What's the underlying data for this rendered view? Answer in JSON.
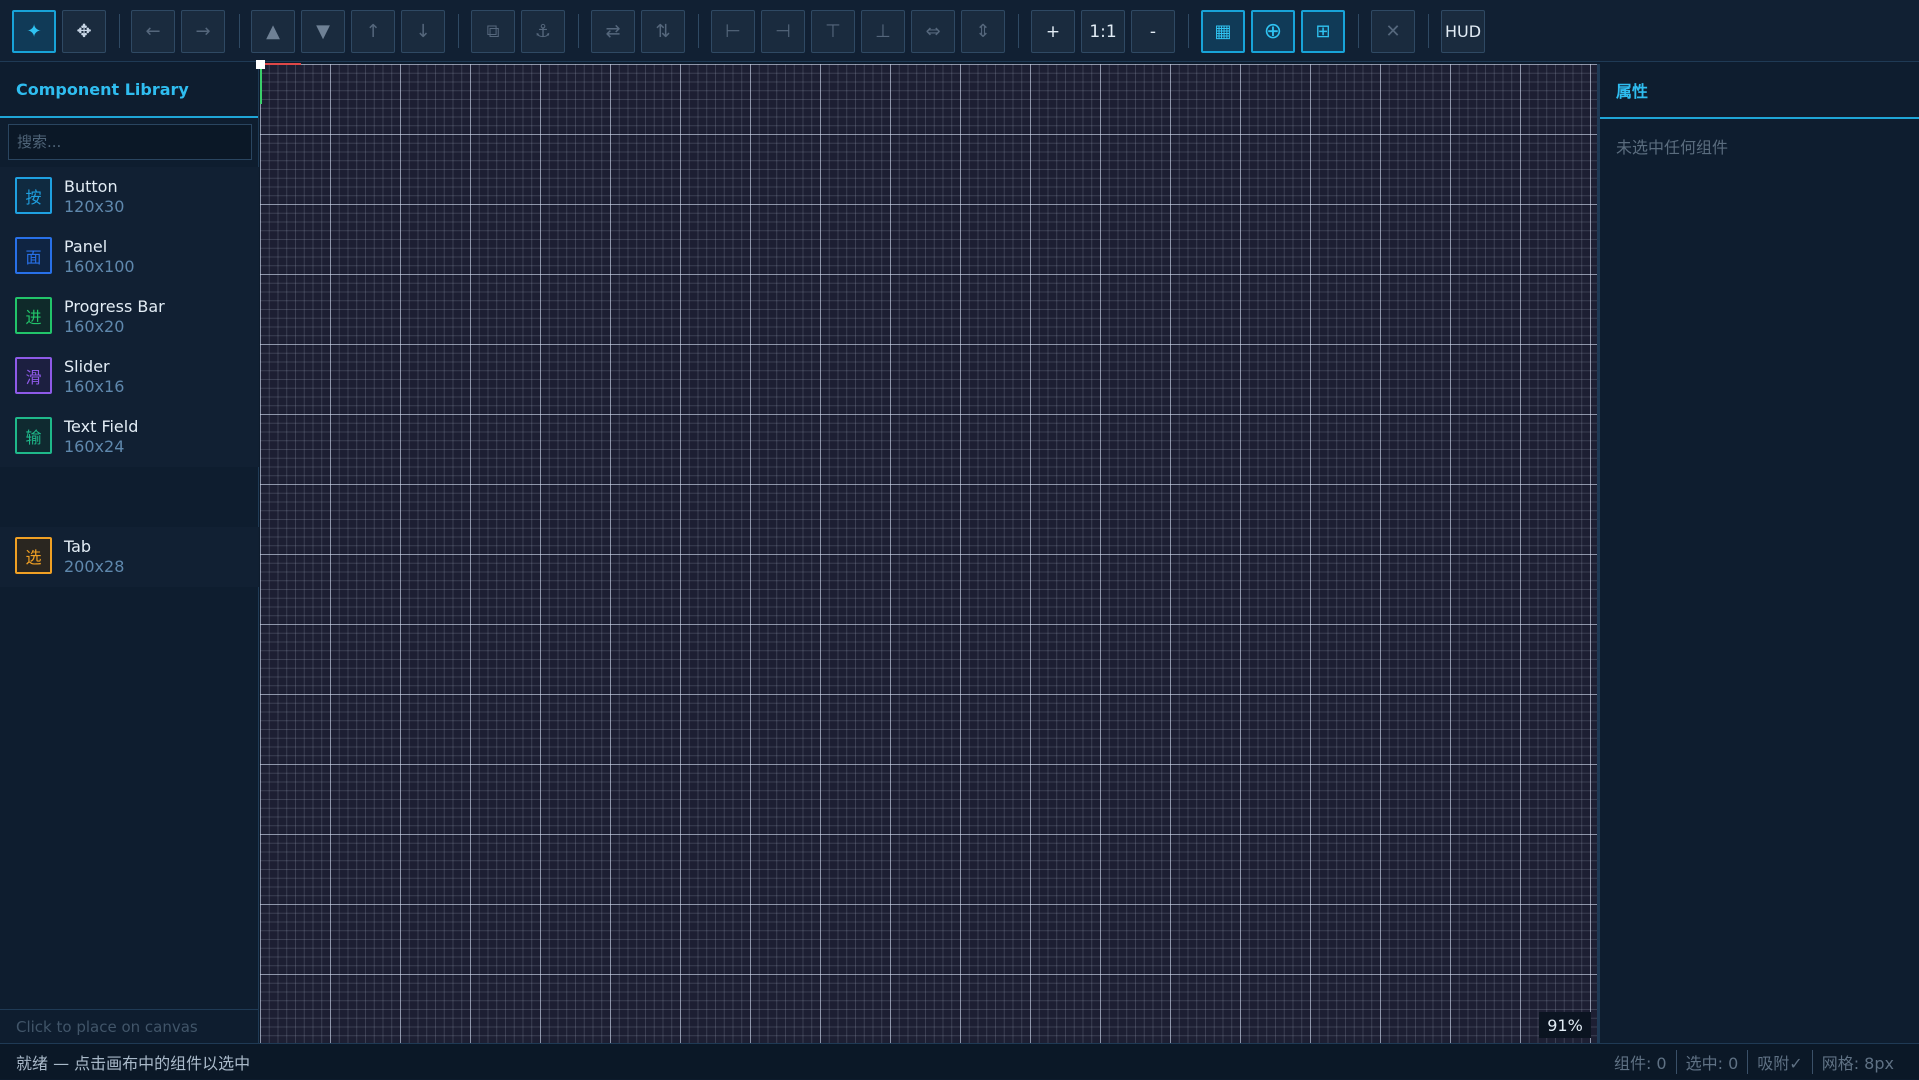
{
  "toolbar": {
    "buttons": [
      {
        "id": "select",
        "glyph": "✦",
        "active": true
      },
      {
        "id": "pan",
        "glyph": "✥",
        "active": false
      },
      {
        "id": "undo",
        "glyph": "←"
      },
      {
        "id": "redo",
        "glyph": "→"
      },
      {
        "id": "bring-front",
        "glyph": "▲"
      },
      {
        "id": "send-back",
        "glyph": "▼"
      },
      {
        "id": "move-up",
        "glyph": "↑"
      },
      {
        "id": "move-down",
        "glyph": "↓"
      },
      {
        "id": "duplicate",
        "glyph": "⧉"
      },
      {
        "id": "anchor",
        "glyph": "⚓"
      },
      {
        "id": "flip-h",
        "glyph": "⇄"
      },
      {
        "id": "flip-v",
        "glyph": "⇅"
      },
      {
        "id": "align-left",
        "glyph": "⊢"
      },
      {
        "id": "align-right",
        "glyph": "⊣"
      },
      {
        "id": "align-top",
        "glyph": "⊤"
      },
      {
        "id": "align-bottom",
        "glyph": "⊥"
      },
      {
        "id": "distribute-h",
        "glyph": "⇔"
      },
      {
        "id": "distribute-v",
        "glyph": "⇕"
      },
      {
        "id": "zoom-in",
        "label": "+"
      },
      {
        "id": "zoom-reset",
        "label": "1:1"
      },
      {
        "id": "zoom-out",
        "label": "-"
      },
      {
        "id": "grid-toggle",
        "glyph": "▦",
        "active": true
      },
      {
        "id": "crosshair-toggle",
        "glyph": "⊕",
        "active": true
      },
      {
        "id": "snap-toggle",
        "glyph": "⊞",
        "active": true
      },
      {
        "id": "delete",
        "glyph": "✕"
      },
      {
        "id": "hud",
        "label": "HUD"
      }
    ]
  },
  "left_panel": {
    "title": "Component Library",
    "search_placeholder": "搜索...",
    "footer": "Click to place on canvas",
    "components": [
      {
        "icon": "按",
        "name": "Button",
        "size": "120x30",
        "color": "#1fa0e0"
      },
      {
        "icon": "面",
        "name": "Panel",
        "size": "160x100",
        "color": "#2870e8"
      },
      {
        "icon": "进",
        "name": "Progress Bar",
        "size": "160x20",
        "color": "#22c46a"
      },
      {
        "icon": "滑",
        "name": "Slider",
        "size": "160x16",
        "color": "#8e5ae8"
      },
      {
        "icon": "输",
        "name": "Text Field",
        "size": "160x24",
        "color": "#1fb88a"
      },
      {
        "icon": "选",
        "name": "Tab",
        "size": "200x28",
        "color": "#f0a024"
      }
    ]
  },
  "canvas": {
    "zoom": "91%"
  },
  "right_panel": {
    "title": "属性",
    "empty_text": "未选中任何组件"
  },
  "status": {
    "message": "就绪 — 点击画布中的组件以选中",
    "components": "组件: 0",
    "selected": "选中: 0",
    "snap": "吸附✓",
    "grid": "网格: 8px"
  }
}
